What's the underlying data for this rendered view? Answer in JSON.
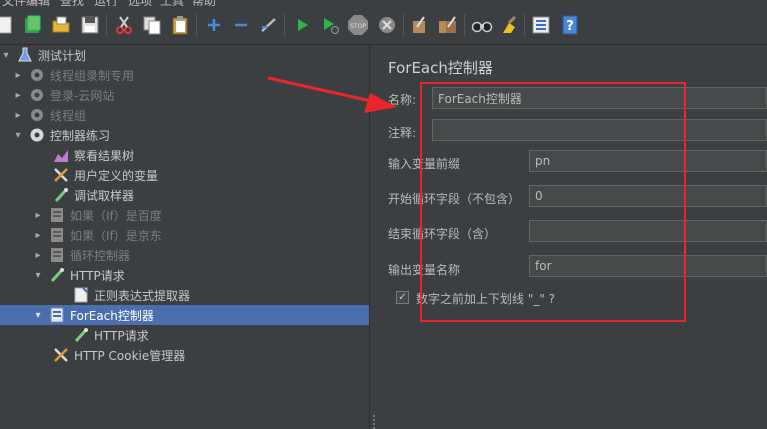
{
  "menu": {
    "items": [
      "文件",
      "编辑",
      "查找",
      "运行",
      "选项",
      "工具",
      "帮助"
    ]
  },
  "toolbar": {
    "icons": [
      "new-icon",
      "templates-icon",
      "open-icon",
      "save-icon",
      "cut-icon",
      "copy-icon",
      "paste-icon",
      "expand-icon",
      "collapse-icon",
      "toggle-icon",
      "start-icon",
      "start-no-pause-icon",
      "stop-icon",
      "shutdown-icon",
      "clear-icon",
      "clear-all-icon",
      "search-icon",
      "reset-search-icon",
      "function-helper-icon",
      "help-icon"
    ]
  },
  "tree": {
    "nodes": [
      {
        "label": "测试计划",
        "icon": "test-plan-icon",
        "expanded": true,
        "disabled": false
      },
      {
        "label": "线程组录制专用",
        "icon": "gear-icon",
        "expanded": false,
        "disabled": true
      },
      {
        "label": "登录-云网站",
        "icon": "gear-icon",
        "expanded": false,
        "disabled": true
      },
      {
        "label": "线程组",
        "icon": "gear-icon",
        "expanded": false,
        "disabled": true
      },
      {
        "label": "控制器练习",
        "icon": "gear-icon",
        "expanded": true,
        "disabled": false
      },
      {
        "label": "察看结果树",
        "icon": "chart-icon",
        "disabled": false
      },
      {
        "label": "用户定义的变量",
        "icon": "wrench-icon",
        "disabled": false
      },
      {
        "label": "调试取样器",
        "icon": "pipette-icon",
        "disabled": false
      },
      {
        "label": "如果（If）是百度",
        "icon": "controller-icon",
        "expanded": false,
        "disabled": true
      },
      {
        "label": "如果（If）是京东",
        "icon": "controller-icon",
        "expanded": false,
        "disabled": true
      },
      {
        "label": "循环控制器",
        "icon": "controller-icon",
        "expanded": false,
        "disabled": true
      },
      {
        "label": "HTTP请求",
        "icon": "pipette-icon",
        "expanded": true,
        "disabled": false
      },
      {
        "label": "正则表达式提取器",
        "icon": "document-icon",
        "disabled": false
      },
      {
        "label": "ForEach控制器",
        "icon": "controller-icon",
        "expanded": true,
        "disabled": false,
        "selected": true
      },
      {
        "label": "HTTP请求",
        "icon": "pipette-icon",
        "disabled": false
      },
      {
        "label": "HTTP Cookie管理器",
        "icon": "wrench-icon",
        "disabled": false
      }
    ]
  },
  "panel": {
    "title": "ForEach控制器",
    "name_label": "名称:",
    "name_value": "ForEach控制器",
    "comment_label": "注释:",
    "comment_value": "",
    "input_prefix_label": "输入变量前缀",
    "input_prefix_value": "pn",
    "start_index_label": "开始循环字段（不包含）",
    "start_index_value": "0",
    "end_index_label": "结束循环字段（含）",
    "end_index_value": "",
    "output_var_label": "输出变量名称",
    "output_var_value": "for",
    "underscore_label": "数字之前加上下划线 \"_\" ?",
    "underscore_checked": true
  },
  "colors": {
    "annotation": "#e8262b",
    "selection": "#4b6eaf",
    "background": "#3c3f41"
  }
}
